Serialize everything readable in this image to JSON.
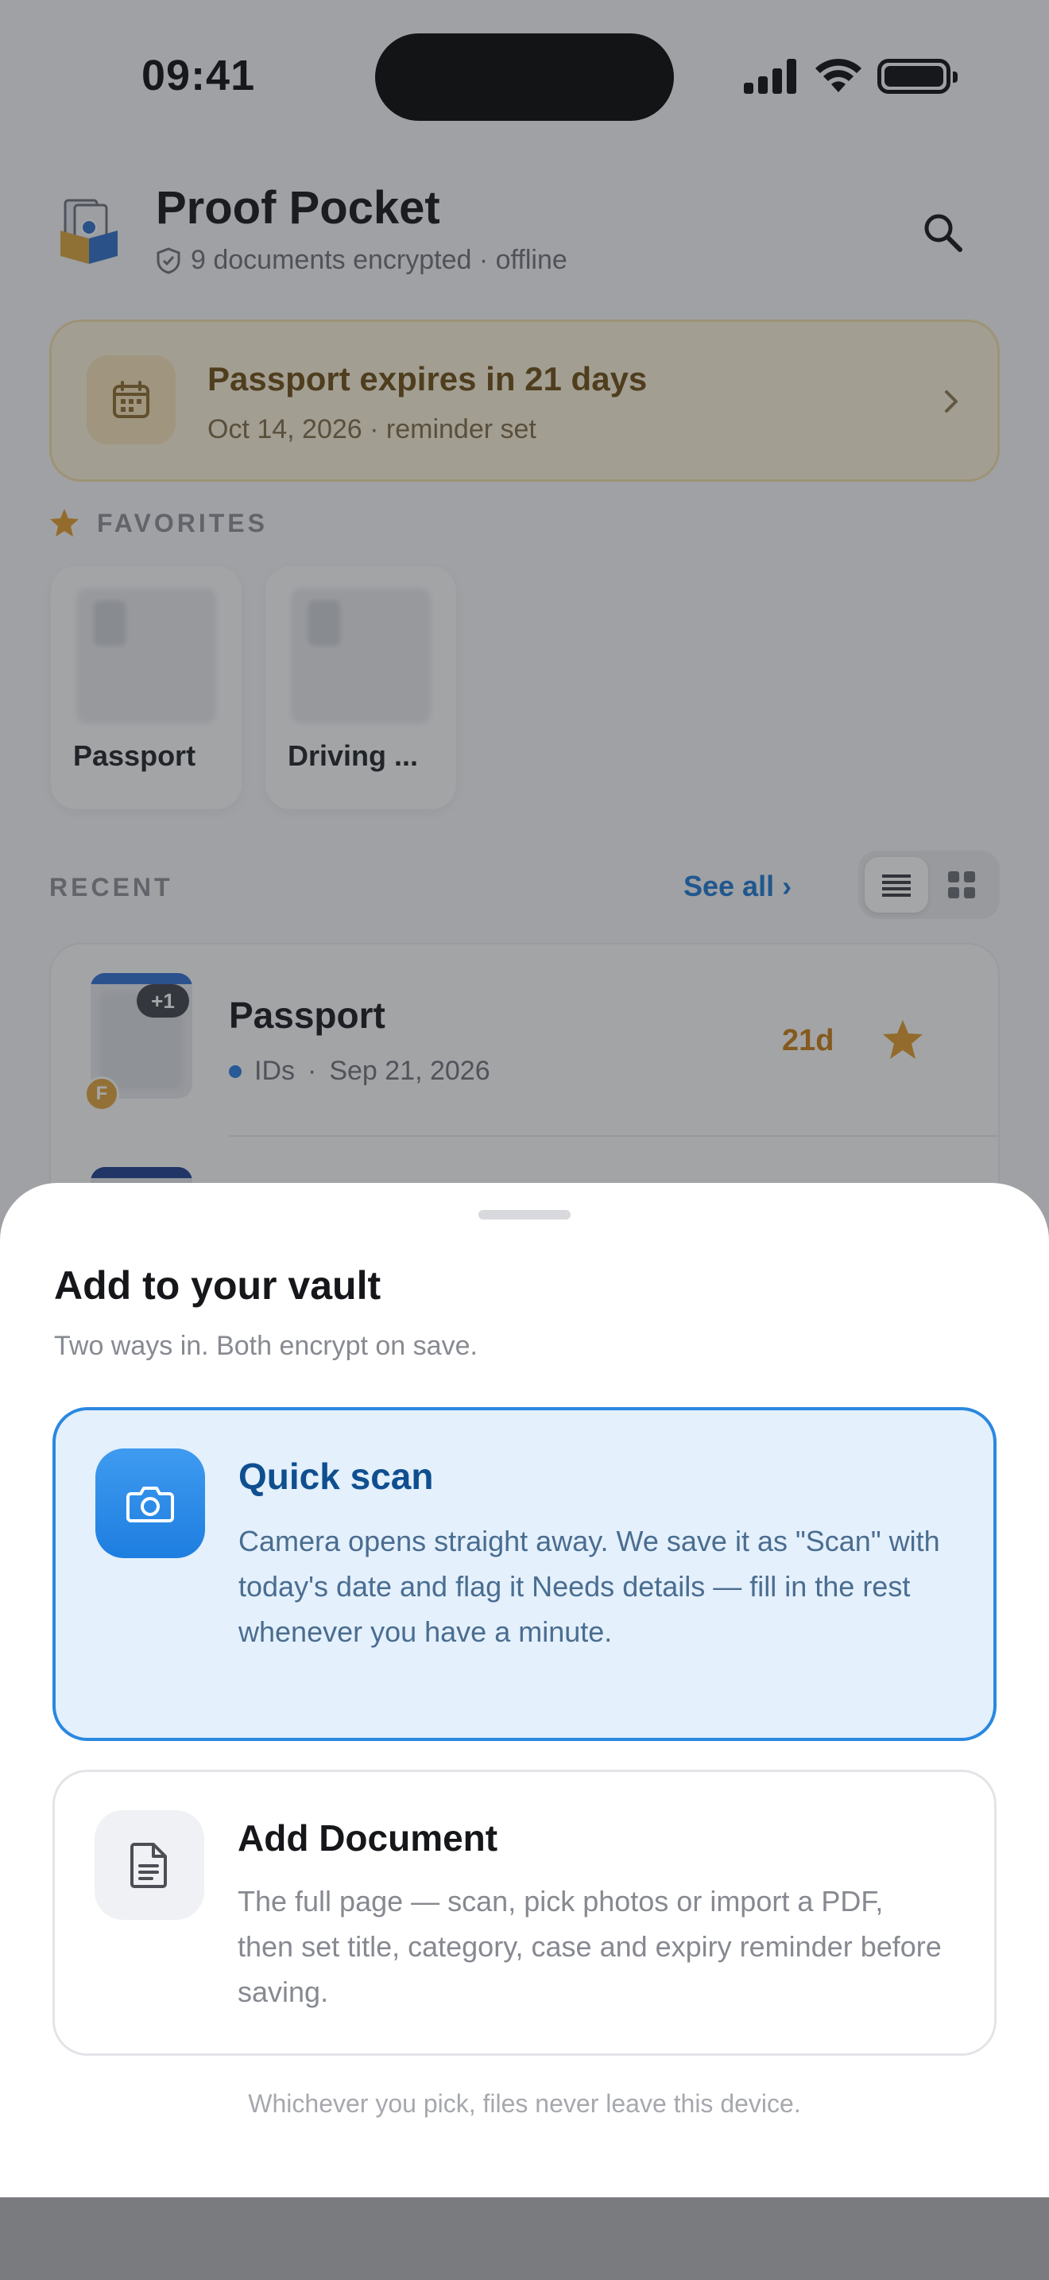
{
  "status_bar": {
    "time": "09:41"
  },
  "header": {
    "title": "Proof Pocket",
    "subtitle": "9 documents encrypted · offline"
  },
  "reminder": {
    "title": "Passport expires in 21 days",
    "subtitle": "Oct 14, 2026 · reminder set"
  },
  "favorites": {
    "label": "FAVORITES",
    "items": [
      {
        "label": "Passport"
      },
      {
        "label": "Driving ..."
      }
    ]
  },
  "recent": {
    "label": "RECENT",
    "see_all": "See all ›",
    "rows": [
      {
        "title": "Passport",
        "category": "IDs",
        "separator": "·",
        "date": "Sep 21, 2026",
        "days": "21d",
        "extra_pages": "+1",
        "owner_initial": "F"
      }
    ]
  },
  "sheet": {
    "title": "Add to your vault",
    "subtitle": "Two ways in. Both encrypt on save.",
    "options": [
      {
        "title": "Quick scan",
        "description": "Camera opens straight away. We save it as \"Scan\" with today's date and flag it Needs details — fill in the rest whenever you have a minute.",
        "icon": "camera-icon"
      },
      {
        "title": "Add Document",
        "description": "The full page — scan, pick photos or import a PDF, then set title, category, case and expiry reminder before saving.",
        "icon": "document-icon"
      }
    ],
    "footer": "Whichever you pick, files never leave this device."
  },
  "colors": {
    "accent": "#1b78d3",
    "warning": "#c77d12",
    "primary_option_bg": "#e4f0fc"
  }
}
